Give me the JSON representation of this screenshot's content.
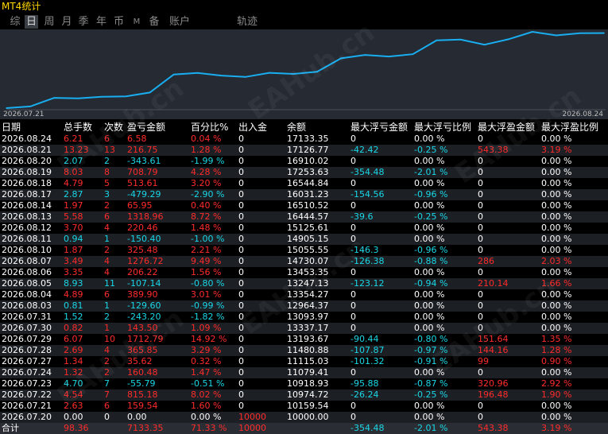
{
  "app_title": "MT4统计",
  "tabs": [
    {
      "label": "综",
      "active": false
    },
    {
      "label": "日",
      "active": true
    },
    {
      "label": "周",
      "active": false
    },
    {
      "label": "月",
      "active": false
    },
    {
      "label": "季",
      "active": false
    },
    {
      "label": "年",
      "active": false
    },
    {
      "label": "币",
      "active": false
    },
    {
      "label": "M",
      "active": false
    },
    {
      "label": "备",
      "active": false
    },
    {
      "label": "账户",
      "active": false
    },
    {
      "label": "轨迹",
      "active": false
    }
  ],
  "watermark": "EAHub.cn",
  "chart": {
    "start_date": "2026.07.21",
    "end_date": "2026.08.24",
    "line_color": "#19aef0"
  },
  "chart_data": {
    "type": "line",
    "x": [
      "2026.07.20",
      "2026.07.21",
      "2026.07.22",
      "2026.07.23",
      "2026.07.24",
      "2026.07.27",
      "2026.07.28",
      "2026.07.29",
      "2026.07.30",
      "2026.07.31",
      "2026.08.03",
      "2026.08.04",
      "2026.08.05",
      "2026.08.06",
      "2026.08.07",
      "2026.08.10",
      "2026.08.11",
      "2026.08.12",
      "2026.08.13",
      "2026.08.14",
      "2026.08.17",
      "2026.08.18",
      "2026.08.19",
      "2026.08.20",
      "2026.08.21",
      "2026.08.24"
    ],
    "values": [
      10000.0,
      10159.54,
      10974.72,
      10918.93,
      11079.41,
      11115.03,
      11480.88,
      13193.67,
      13337.17,
      13093.97,
      12964.37,
      13354.27,
      13247.13,
      13453.35,
      14730.07,
      15055.55,
      14905.15,
      15125.61,
      16444.57,
      16510.52,
      16031.23,
      16544.84,
      17253.63,
      16910.02,
      17126.77,
      17133.35
    ]
  },
  "columns": [
    "日期",
    "总手数",
    "次数",
    "盈亏金额",
    "百分比%",
    "出入金",
    "余额",
    "最大浮亏金额",
    "最大浮亏比例",
    "最大浮盈金额",
    "最大浮盈比例"
  ],
  "rows": [
    {
      "date": "2026.08.24",
      "lots": "6.21",
      "count": "6",
      "pnl": "6.58",
      "pct": "0.04 %",
      "dep": "0",
      "bal": "17133.35",
      "mfl": "0",
      "mflp": "0.00 %",
      "mfp": "0",
      "mfpp": "0.00 %",
      "color": "red"
    },
    {
      "date": "2026.08.21",
      "lots": "13.23",
      "count": "13",
      "pnl": "216.75",
      "pct": "1.28 %",
      "dep": "0",
      "bal": "17126.77",
      "mfl": "-42.42",
      "mflp": "-0.25 %",
      "mfp": "543.38",
      "mfpp": "3.19 %",
      "color": "red"
    },
    {
      "date": "2026.08.20",
      "lots": "2.07",
      "count": "2",
      "pnl": "-343.61",
      "pct": "-1.99 %",
      "dep": "0",
      "bal": "16910.02",
      "mfl": "0",
      "mflp": "0.00 %",
      "mfp": "0",
      "mfpp": "0.00 %",
      "color": "cyan"
    },
    {
      "date": "2026.08.19",
      "lots": "8.03",
      "count": "8",
      "pnl": "708.79",
      "pct": "4.28 %",
      "dep": "0",
      "bal": "17253.63",
      "mfl": "-354.48",
      "mflp": "-2.01 %",
      "mfp": "0",
      "mfpp": "0.00 %",
      "color": "red"
    },
    {
      "date": "2026.08.18",
      "lots": "4.79",
      "count": "5",
      "pnl": "513.61",
      "pct": "3.20 %",
      "dep": "0",
      "bal": "16544.84",
      "mfl": "0",
      "mflp": "0.00 %",
      "mfp": "0",
      "mfpp": "0.00 %",
      "color": "red"
    },
    {
      "date": "2026.08.17",
      "lots": "2.87",
      "count": "3",
      "pnl": "-479.29",
      "pct": "-2.90 %",
      "dep": "0",
      "bal": "16031.23",
      "mfl": "-154.56",
      "mflp": "-0.96 %",
      "mfp": "0",
      "mfpp": "0.00 %",
      "color": "cyan"
    },
    {
      "date": "2026.08.14",
      "lots": "1.97",
      "count": "2",
      "pnl": "65.95",
      "pct": "0.40 %",
      "dep": "0",
      "bal": "16510.52",
      "mfl": "0",
      "mflp": "0.00 %",
      "mfp": "0",
      "mfpp": "0.00 %",
      "color": "red"
    },
    {
      "date": "2026.08.13",
      "lots": "5.58",
      "count": "6",
      "pnl": "1318.96",
      "pct": "8.72 %",
      "dep": "0",
      "bal": "16444.57",
      "mfl": "-39.6",
      "mflp": "-0.25 %",
      "mfp": "0",
      "mfpp": "0.00 %",
      "color": "red"
    },
    {
      "date": "2026.08.12",
      "lots": "3.70",
      "count": "4",
      "pnl": "220.46",
      "pct": "1.48 %",
      "dep": "0",
      "bal": "15125.61",
      "mfl": "0",
      "mflp": "0.00 %",
      "mfp": "0",
      "mfpp": "0.00 %",
      "color": "red"
    },
    {
      "date": "2026.08.11",
      "lots": "0.94",
      "count": "1",
      "pnl": "-150.40",
      "pct": "-1.00 %",
      "dep": "0",
      "bal": "14905.15",
      "mfl": "0",
      "mflp": "0.00 %",
      "mfp": "0",
      "mfpp": "0.00 %",
      "color": "cyan"
    },
    {
      "date": "2026.08.10",
      "lots": "1.87",
      "count": "2",
      "pnl": "325.48",
      "pct": "2.21 %",
      "dep": "0",
      "bal": "15055.55",
      "mfl": "-146.3",
      "mflp": "-0.96 %",
      "mfp": "0",
      "mfpp": "0.00 %",
      "color": "red"
    },
    {
      "date": "2026.08.07",
      "lots": "3.49",
      "count": "4",
      "pnl": "1276.72",
      "pct": "9.49 %",
      "dep": "0",
      "bal": "14730.07",
      "mfl": "-126.38",
      "mflp": "-0.88 %",
      "mfp": "286",
      "mfpp": "2.03 %",
      "color": "red"
    },
    {
      "date": "2026.08.06",
      "lots": "3.35",
      "count": "4",
      "pnl": "206.22",
      "pct": "1.56 %",
      "dep": "0",
      "bal": "13453.35",
      "mfl": "0",
      "mflp": "0.00 %",
      "mfp": "0",
      "mfpp": "0.00 %",
      "color": "red"
    },
    {
      "date": "2026.08.05",
      "lots": "8.93",
      "count": "11",
      "pnl": "-107.14",
      "pct": "-0.80 %",
      "dep": "0",
      "bal": "13247.13",
      "mfl": "-123.12",
      "mflp": "-0.94 %",
      "mfp": "210.14",
      "mfpp": "1.66 %",
      "color": "cyan"
    },
    {
      "date": "2026.08.04",
      "lots": "4.89",
      "count": "6",
      "pnl": "389.90",
      "pct": "3.01 %",
      "dep": "0",
      "bal": "13354.27",
      "mfl": "0",
      "mflp": "0.00 %",
      "mfp": "0",
      "mfpp": "0.00 %",
      "color": "red"
    },
    {
      "date": "2026.08.03",
      "lots": "0.81",
      "count": "1",
      "pnl": "-129.60",
      "pct": "-0.99 %",
      "dep": "0",
      "bal": "12964.37",
      "mfl": "0",
      "mflp": "0.00 %",
      "mfp": "0",
      "mfpp": "0.00 %",
      "color": "cyan"
    },
    {
      "date": "2026.07.31",
      "lots": "1.52",
      "count": "2",
      "pnl": "-243.20",
      "pct": "-1.82 %",
      "dep": "0",
      "bal": "13093.97",
      "mfl": "0",
      "mflp": "0.00 %",
      "mfp": "0",
      "mfpp": "0.00 %",
      "color": "cyan"
    },
    {
      "date": "2026.07.30",
      "lots": "0.82",
      "count": "1",
      "pnl": "143.50",
      "pct": "1.09 %",
      "dep": "0",
      "bal": "13337.17",
      "mfl": "0",
      "mflp": "0.00 %",
      "mfp": "0",
      "mfpp": "0.00 %",
      "color": "red"
    },
    {
      "date": "2026.07.29",
      "lots": "6.07",
      "count": "10",
      "pnl": "1712.79",
      "pct": "14.92 %",
      "dep": "0",
      "bal": "13193.67",
      "mfl": "-90.44",
      "mflp": "-0.80 %",
      "mfp": "151.64",
      "mfpp": "1.35 %",
      "color": "red"
    },
    {
      "date": "2026.07.28",
      "lots": "2.69",
      "count": "4",
      "pnl": "365.85",
      "pct": "3.29 %",
      "dep": "0",
      "bal": "11480.88",
      "mfl": "-107.87",
      "mflp": "-0.97 %",
      "mfp": "144.16",
      "mfpp": "1.28 %",
      "color": "red"
    },
    {
      "date": "2026.07.27",
      "lots": "1.34",
      "count": "2",
      "pnl": "35.62",
      "pct": "0.32 %",
      "dep": "0",
      "bal": "11115.03",
      "mfl": "-101.32",
      "mflp": "-0.91 %",
      "mfp": "99",
      "mfpp": "0.90 %",
      "color": "red"
    },
    {
      "date": "2026.07.24",
      "lots": "1.32",
      "count": "2",
      "pnl": "160.48",
      "pct": "1.47 %",
      "dep": "0",
      "bal": "11079.41",
      "mfl": "0",
      "mflp": "0.00 %",
      "mfp": "0",
      "mfpp": "0.00 %",
      "color": "red"
    },
    {
      "date": "2026.07.23",
      "lots": "4.70",
      "count": "7",
      "pnl": "-55.79",
      "pct": "-0.51 %",
      "dep": "0",
      "bal": "10918.93",
      "mfl": "-95.88",
      "mflp": "-0.87 %",
      "mfp": "320.96",
      "mfpp": "2.92 %",
      "color": "cyan"
    },
    {
      "date": "2026.07.22",
      "lots": "4.54",
      "count": "7",
      "pnl": "815.18",
      "pct": "8.02 %",
      "dep": "0",
      "bal": "10974.72",
      "mfl": "-26.24",
      "mflp": "-0.25 %",
      "mfp": "196.48",
      "mfpp": "1.90 %",
      "color": "red"
    },
    {
      "date": "2026.07.21",
      "lots": "2.63",
      "count": "6",
      "pnl": "159.54",
      "pct": "1.60 %",
      "dep": "0",
      "bal": "10159.54",
      "mfl": "0",
      "mflp": "0.00 %",
      "mfp": "0",
      "mfpp": "0.00 %",
      "color": "red"
    },
    {
      "date": "2026.07.20",
      "lots": "0.00",
      "count": "0",
      "pnl": "0.00",
      "pct": "0.00 %",
      "dep": "10000",
      "bal": "10000.00",
      "mfl": "0",
      "mflp": "0.00 %",
      "mfp": "0",
      "mfpp": "0.00 %",
      "color": "white"
    }
  ],
  "total": {
    "label": "合计",
    "lots": "98.36",
    "count": "",
    "pnl": "7133.35",
    "pct": "71.33 %",
    "dep": "10000",
    "bal": "",
    "mfl": "-354.48",
    "mflp": "-2.01 %",
    "mfp": "543.38",
    "mfpp": "3.19 %"
  },
  "colors": {
    "positive": "#ff2b2b",
    "negative": "#19d7e6",
    "deposit": "#ff2b2b",
    "header": "#ffffff",
    "title": "#ffd800"
  }
}
